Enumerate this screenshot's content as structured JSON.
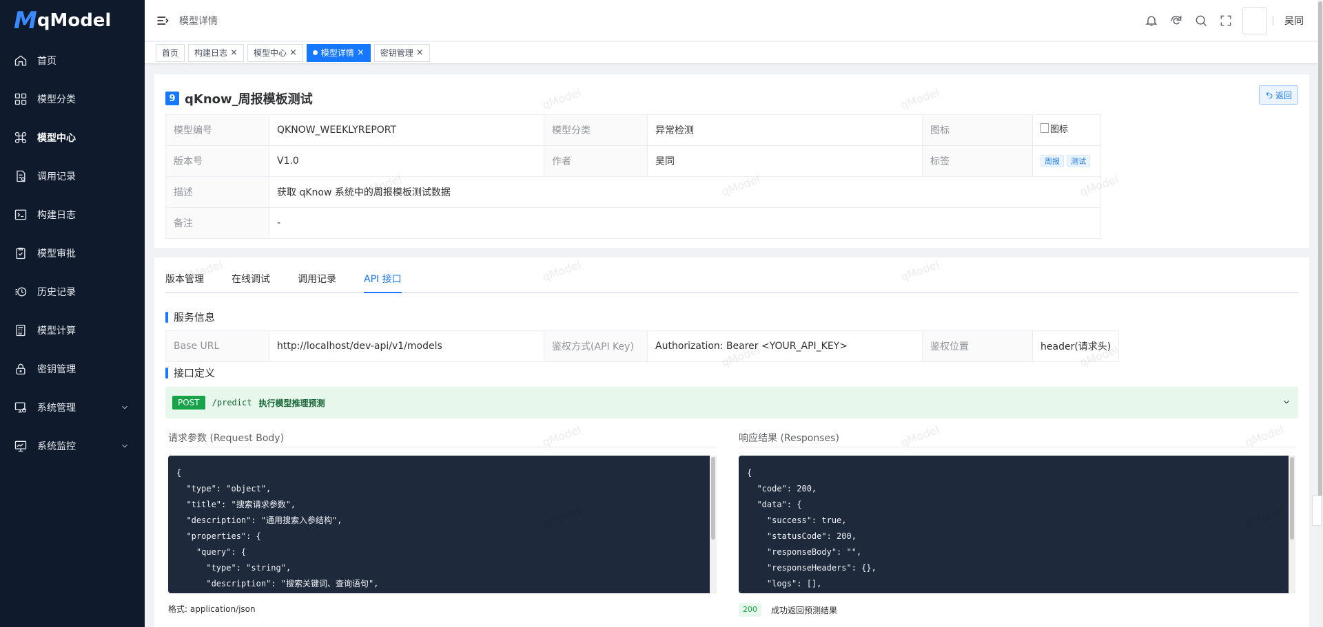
{
  "brand": {
    "mark": "M",
    "name": "qModel"
  },
  "sidebar": {
    "items": [
      {
        "label": "首页",
        "icon": "home-icon"
      },
      {
        "label": "模型分类",
        "icon": "grid-icon"
      },
      {
        "label": "模型中心",
        "icon": "command-icon",
        "active": true
      },
      {
        "label": "调用记录",
        "icon": "document-icon"
      },
      {
        "label": "构建日志",
        "icon": "terminal-icon"
      },
      {
        "label": "模型审批",
        "icon": "clipboard-check-icon"
      },
      {
        "label": "历史记录",
        "icon": "history-icon"
      },
      {
        "label": "模型计算",
        "icon": "calculator-icon"
      },
      {
        "label": "密钥管理",
        "icon": "lock-icon"
      },
      {
        "label": "系统管理",
        "icon": "monitor-settings-icon",
        "expandable": true
      },
      {
        "label": "系统监控",
        "icon": "monitor-chart-icon",
        "expandable": true
      }
    ]
  },
  "header": {
    "breadcrumb": "模型详情",
    "user_name": "吴同"
  },
  "tags": [
    {
      "label": "首页",
      "closable": false
    },
    {
      "label": "构建日志",
      "closable": true
    },
    {
      "label": "模型中心",
      "closable": true
    },
    {
      "label": "模型详情",
      "closable": true,
      "active": true
    },
    {
      "label": "密钥管理",
      "closable": true
    }
  ],
  "model": {
    "index": "9",
    "title": "qKnow_周报模板测试",
    "back_label": "返回",
    "fields": {
      "code_label": "模型编号",
      "code": "QKNOW_WEEKLYREPORT",
      "category_label": "模型分类",
      "category": "异常检测",
      "icon_label": "图标",
      "icon_alt": "图标",
      "version_label": "版本号",
      "version": "V1.0",
      "author_label": "作者",
      "author": "吴同",
      "tags_label": "标签",
      "tag1": "周报",
      "tag2": "测试",
      "desc_label": "描述",
      "desc": "获取 qKnow 系统中的周报模板测试数据",
      "remark_label": "备注",
      "remark": "-"
    }
  },
  "tabs": [
    "版本管理",
    "在线调试",
    "调用记录",
    "API 接口"
  ],
  "active_tab": 3,
  "service": {
    "section_title": "服务信息",
    "base_url_label": "Base URL",
    "base_url": "http://localhost/dev-api/v1/models",
    "auth_label": "鉴权方式(API Key)",
    "auth": "Authorization: Bearer <YOUR_API_KEY>",
    "auth_pos_label": "鉴权位置",
    "auth_pos": "header(请求头)"
  },
  "api": {
    "section_title": "接口定义",
    "method": "POST",
    "path": "/predict",
    "description": "执行模型推理预测",
    "request_title": "请求参数 (Request Body)",
    "request_code": "{\n  \"type\": \"object\",\n  \"title\": \"搜索请求参数\",\n  \"description\": \"通用搜索入参结构\",\n  \"properties\": {\n    \"query\": {\n      \"type\": \"string\",\n      \"description\": \"搜索关键词、查询语句\",",
    "request_format": "格式: application/json",
    "response_title": "响应结果 (Responses)",
    "response_code": "{\n  \"code\": 200,\n  \"data\": {\n    \"success\": true,\n    \"statusCode\": 200,\n    \"responseBody\": \"\",\n    \"responseHeaders\": {},\n    \"logs\": [],",
    "response_status": "200",
    "response_status_desc": "成功返回预测结果"
  },
  "watermark": "qModel",
  "colors": {
    "sidebar_bg": "#0f1b2d",
    "primary": "#1677ff",
    "success": "#16a34a"
  }
}
